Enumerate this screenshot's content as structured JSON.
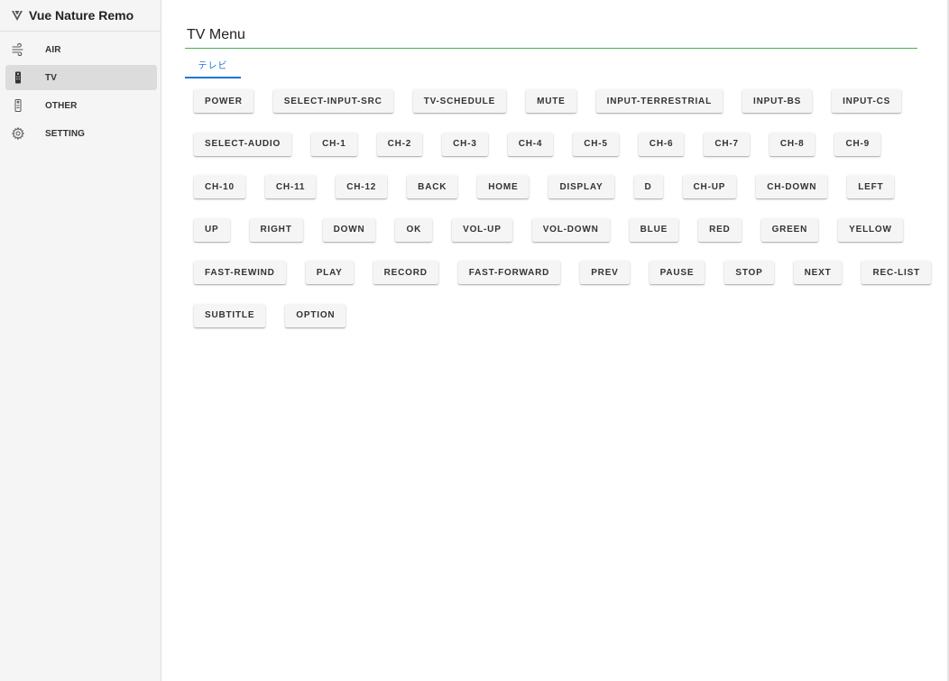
{
  "app": {
    "title": "Vue Nature Remo"
  },
  "sidebar": {
    "items": [
      {
        "label": "AIR",
        "icon": "wind-icon",
        "active": false
      },
      {
        "label": "TV",
        "icon": "remote-icon",
        "active": true
      },
      {
        "label": "OTHER",
        "icon": "remote-outline-icon",
        "active": false
      },
      {
        "label": "SETTING",
        "icon": "gear-icon",
        "active": false
      }
    ]
  },
  "main": {
    "title": "TV Menu",
    "tabs": [
      {
        "label": "テレビ",
        "active": true
      }
    ],
    "accent_color": "#4caf50",
    "tab_color": "#1976d2",
    "button_rows": [
      [
        "POWER",
        "SELECT-INPUT-SRC",
        "TV-SCHEDULE",
        "MUTE",
        "INPUT-TERRESTRIAL",
        "INPUT-BS",
        "INPUT-CS"
      ],
      [
        "SELECT-AUDIO",
        "CH-1",
        "CH-2",
        "CH-3",
        "CH-4",
        "CH-5",
        "CH-6",
        "CH-7",
        "CH-8",
        "CH-9"
      ],
      [
        "CH-10",
        "CH-11",
        "CH-12",
        "BACK",
        "HOME",
        "DISPLAY",
        "D",
        "CH-UP",
        "CH-DOWN",
        "LEFT"
      ],
      [
        "UP",
        "RIGHT",
        "DOWN",
        "OK",
        "VOL-UP",
        "VOL-DOWN",
        "BLUE",
        "RED",
        "GREEN",
        "YELLOW"
      ],
      [
        "FAST-REWIND",
        "PLAY",
        "RECORD",
        "FAST-FORWARD",
        "PREV",
        "PAUSE",
        "STOP",
        "NEXT",
        "REC-LIST"
      ],
      [
        "SUBTITLE",
        "OPTION"
      ]
    ]
  }
}
